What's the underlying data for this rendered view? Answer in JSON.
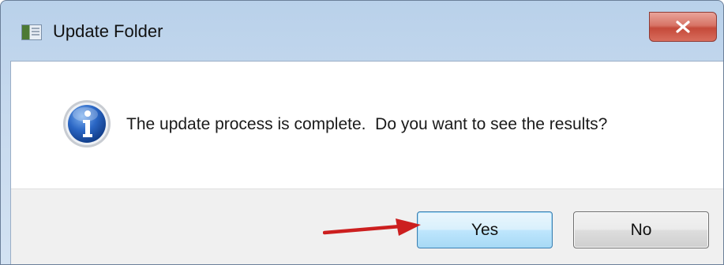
{
  "window": {
    "title": "Update Folder",
    "icon": "app-window-icon"
  },
  "controls": {
    "close_icon": "close-x-icon"
  },
  "dialog": {
    "icon": "information-icon",
    "message": "The update process is complete.  Do you want to see the results?"
  },
  "buttons": {
    "yes_label": "Yes",
    "no_label": "No"
  },
  "annotation": {
    "icon": "red-arrow-pointer",
    "color": "#cc1f1f"
  },
  "colors": {
    "titlebar": "#c6d9ee",
    "close_button": "#c54a3a",
    "footer": "#f0f0f0",
    "default_button_border": "#3c7fb1"
  }
}
